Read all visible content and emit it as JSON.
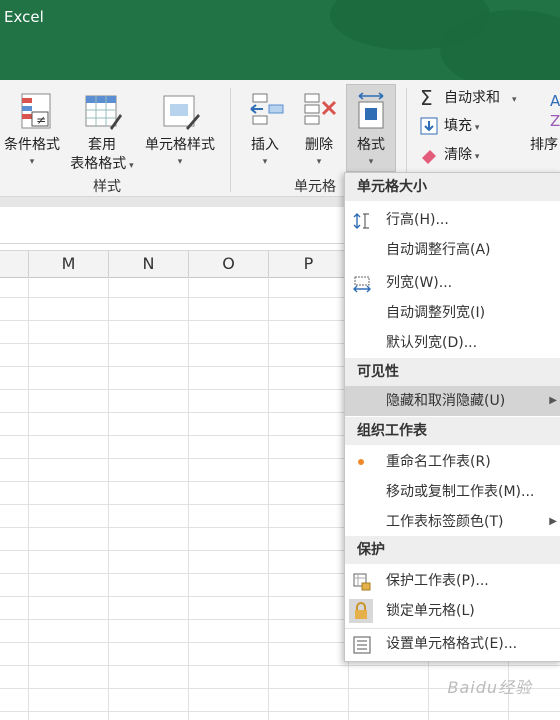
{
  "app": {
    "title": "Excel"
  },
  "ribbon": {
    "styles_group": {
      "label": "样式",
      "conditional_formatting": "条件格式",
      "format_as_table_line1": "套用",
      "format_as_table_line2": "表格格式",
      "cell_styles": "单元格样式"
    },
    "cells_group": {
      "label": "单元格",
      "insert": "插入",
      "delete": "删除",
      "format": "格式"
    },
    "editing_group": {
      "autosum": "自动求和",
      "fill": "填充",
      "clear": "清除",
      "sort_partial": "排序"
    }
  },
  "columns": [
    "M",
    "N",
    "O",
    "P"
  ],
  "menu": {
    "sec_cell_size": "单元格大小",
    "row_height": "行高(H)...",
    "autofit_row_height": "自动调整行高(A)",
    "column_width": "列宽(W)...",
    "autofit_column_width": "自动调整列宽(I)",
    "default_width": "默认列宽(D)...",
    "sec_visibility": "可见性",
    "hide_unhide": "隐藏和取消隐藏(U)",
    "sec_organize": "组织工作表",
    "rename_sheet": "重命名工作表(R)",
    "move_copy_sheet": "移动或复制工作表(M)...",
    "tab_color": "工作表标签颜色(T)",
    "sec_protection": "保护",
    "protect_sheet": "保护工作表(P)...",
    "lock_cell": "锁定单元格(L)",
    "format_cells": "设置单元格格式(E)..."
  },
  "watermark": "Baidu经验",
  "colors": {
    "title_bar": "#217346",
    "menu_highlight": "#d4d4d4",
    "ribbon": "#f3f3f3"
  }
}
